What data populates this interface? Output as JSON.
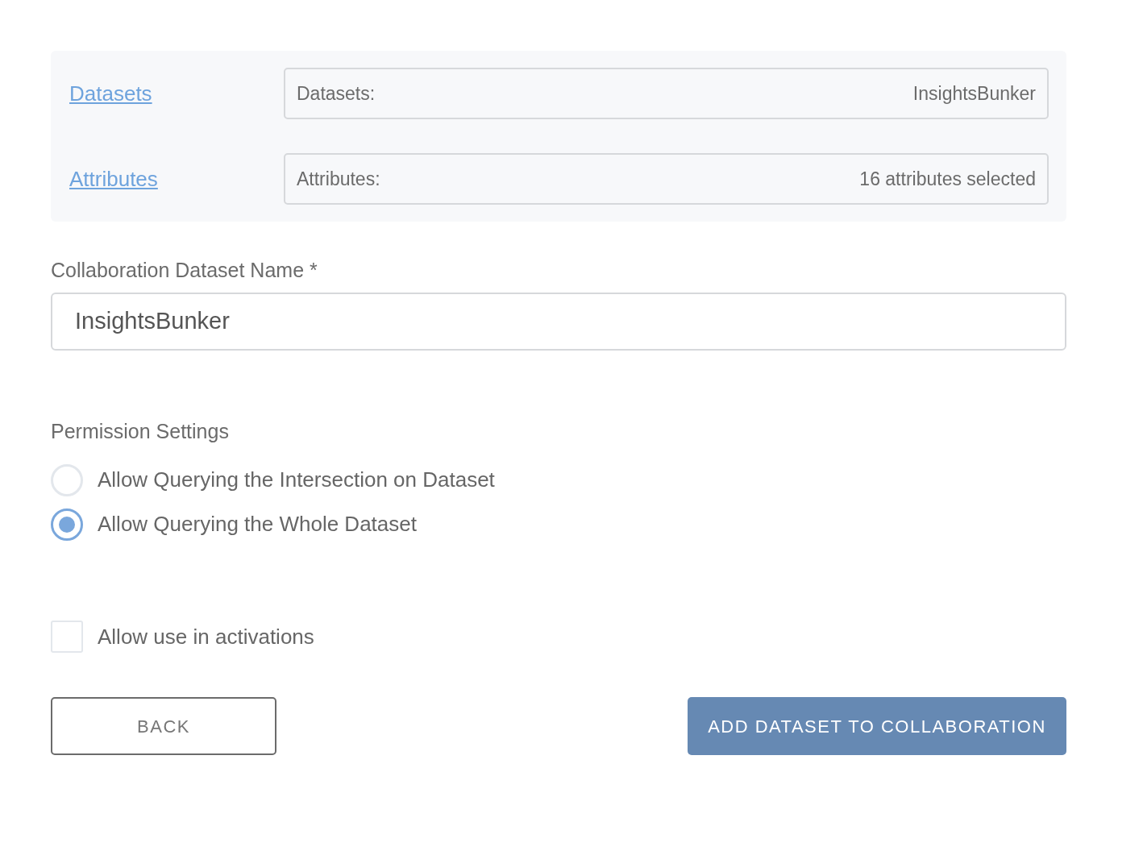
{
  "sources": [
    {
      "link": "Datasets",
      "label": "Datasets:",
      "value": "InsightsBunker"
    },
    {
      "link": "Attributes",
      "label": "Attributes:",
      "value": "16 attributes selected"
    }
  ],
  "name_field": {
    "label": "Collaboration Dataset Name *",
    "value": "InsightsBunker"
  },
  "permissions": {
    "title": "Permission Settings",
    "options": [
      {
        "label": "Allow Querying the Intersection on Dataset",
        "selected": false
      },
      {
        "label": "Allow Querying the Whole Dataset",
        "selected": true
      }
    ]
  },
  "activation": {
    "label": "Allow use in activations",
    "checked": false
  },
  "buttons": [
    {
      "label": "BACK",
      "kind": "secondary"
    },
    {
      "label": "ADD DATASET TO COLLABORATION",
      "kind": "primary"
    }
  ]
}
